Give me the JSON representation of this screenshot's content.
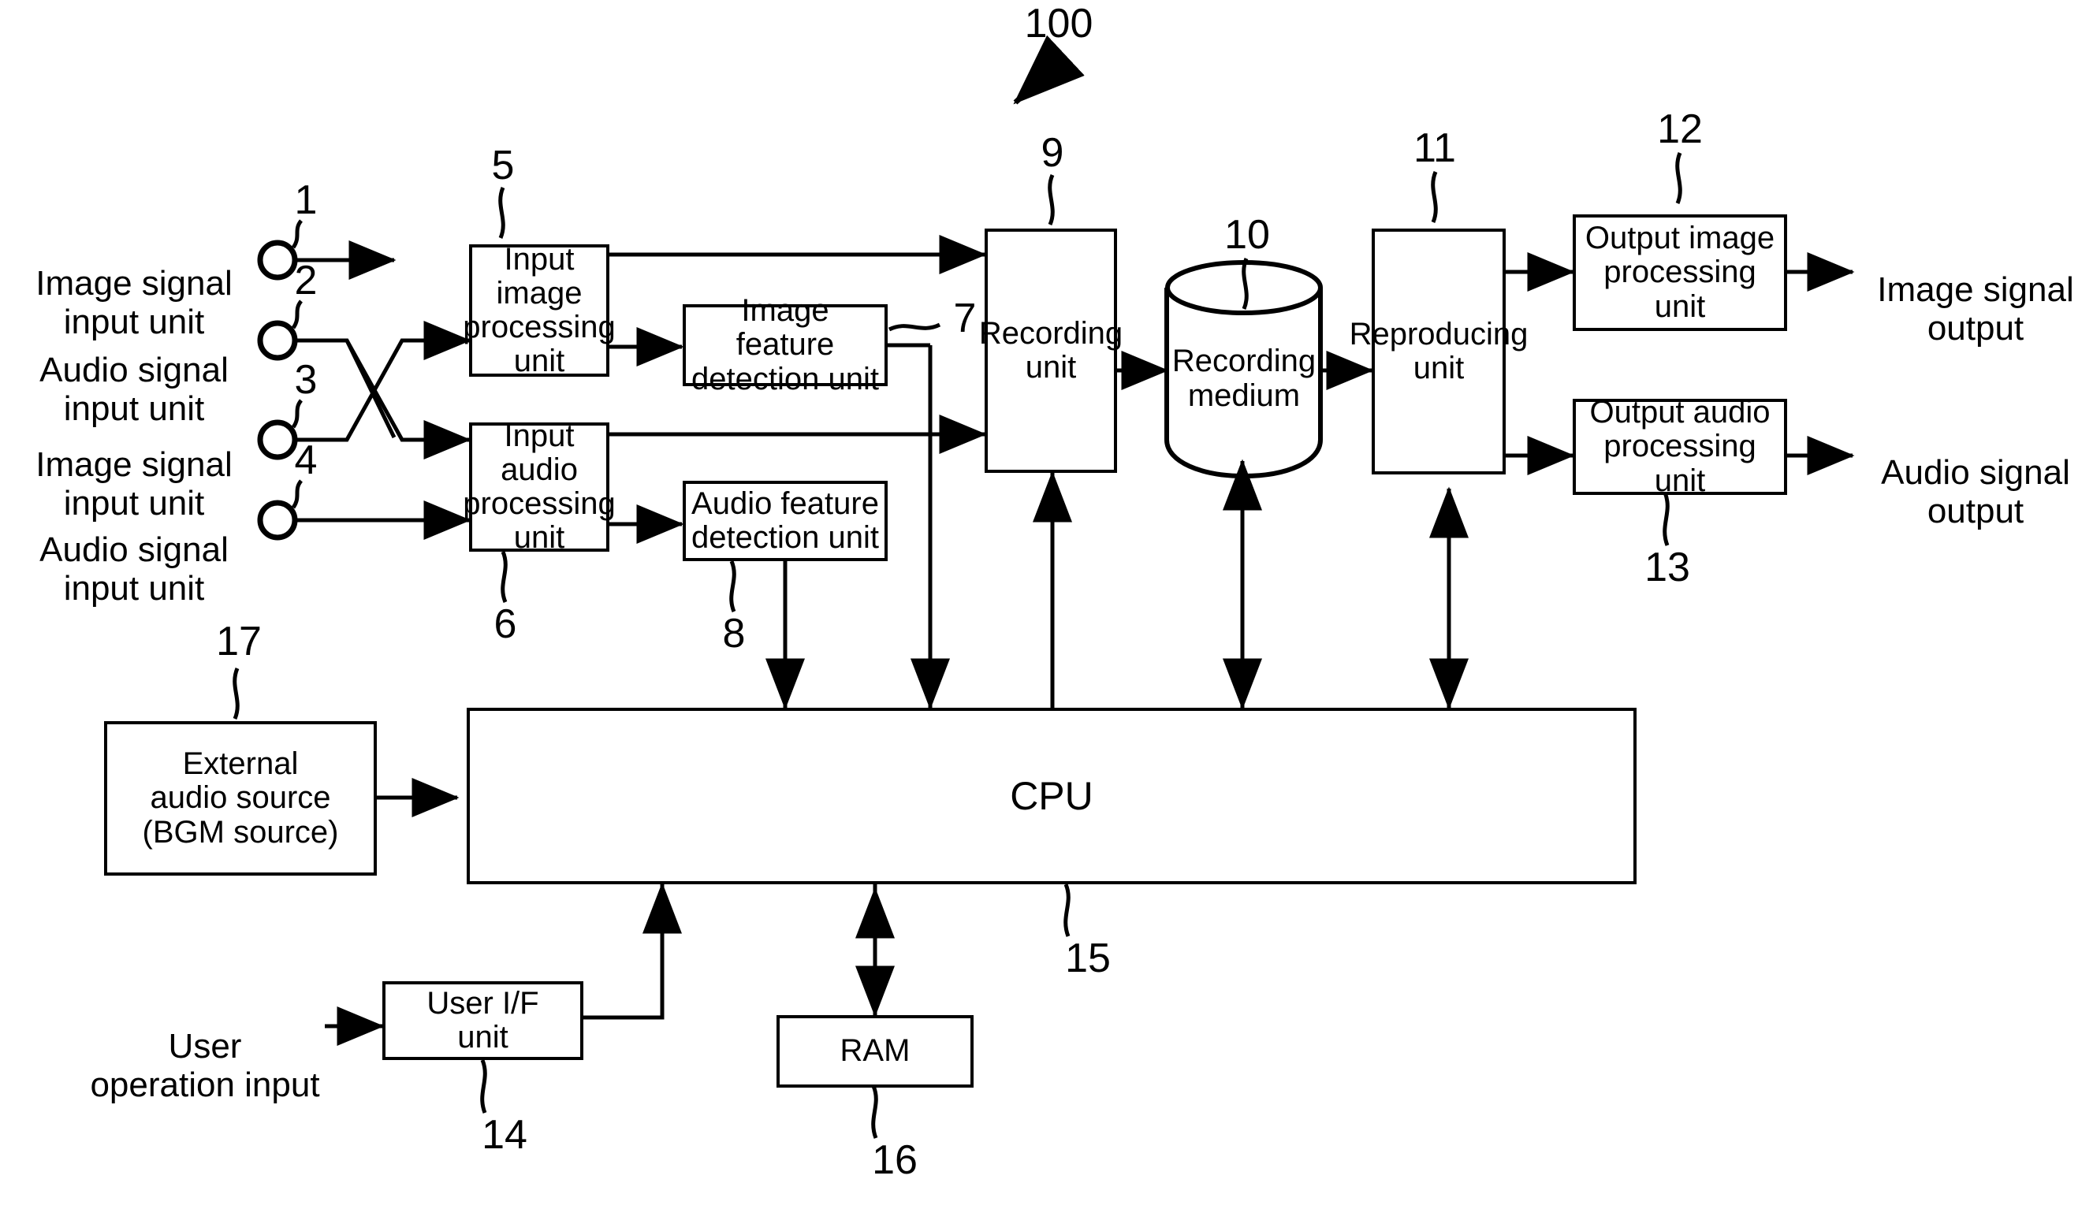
{
  "figure": {
    "system_ref": "100"
  },
  "terminals": [
    {
      "ref": "1",
      "label": "Image signal\ninput unit"
    },
    {
      "ref": "2",
      "label": "Audio signal\ninput unit"
    },
    {
      "ref": "3",
      "label": "Image signal\ninput unit"
    },
    {
      "ref": "4",
      "label": "Audio signal\ninput unit"
    }
  ],
  "blocks": {
    "input_image_processing": {
      "ref": "5",
      "label": "Input image\nprocessing\nunit"
    },
    "input_audio_processing": {
      "ref": "6",
      "label": "Input audio\nprocessing\nunit"
    },
    "image_feature_detection": {
      "ref": "7",
      "label": "Image feature\ndetection unit"
    },
    "audio_feature_detection": {
      "ref": "8",
      "label": "Audio feature\ndetection unit"
    },
    "recording_unit": {
      "ref": "9",
      "label": "Recording\nunit"
    },
    "recording_medium": {
      "ref": "10",
      "label": "Recording\nmedium"
    },
    "reproducing_unit": {
      "ref": "11",
      "label": "Reproducing\nunit"
    },
    "output_image_processing": {
      "ref": "12",
      "label": "Output image\nprocessing unit"
    },
    "output_audio_processing": {
      "ref": "13",
      "label": "Output audio\nprocessing unit"
    },
    "user_if_unit": {
      "ref": "14",
      "label": "User I/F\nunit"
    },
    "cpu": {
      "ref": "15",
      "label": "CPU"
    },
    "ram": {
      "ref": "16",
      "label": "RAM"
    },
    "external_audio_source": {
      "ref": "17",
      "label": "External\naudio source\n(BGM source)"
    }
  },
  "io_labels": {
    "image_signal_output": "Image signal\noutput",
    "audio_signal_output": "Audio signal\noutput",
    "user_operation_input": "User\noperation input"
  },
  "colors": {
    "stroke": "#000000",
    "background": "#ffffff"
  }
}
